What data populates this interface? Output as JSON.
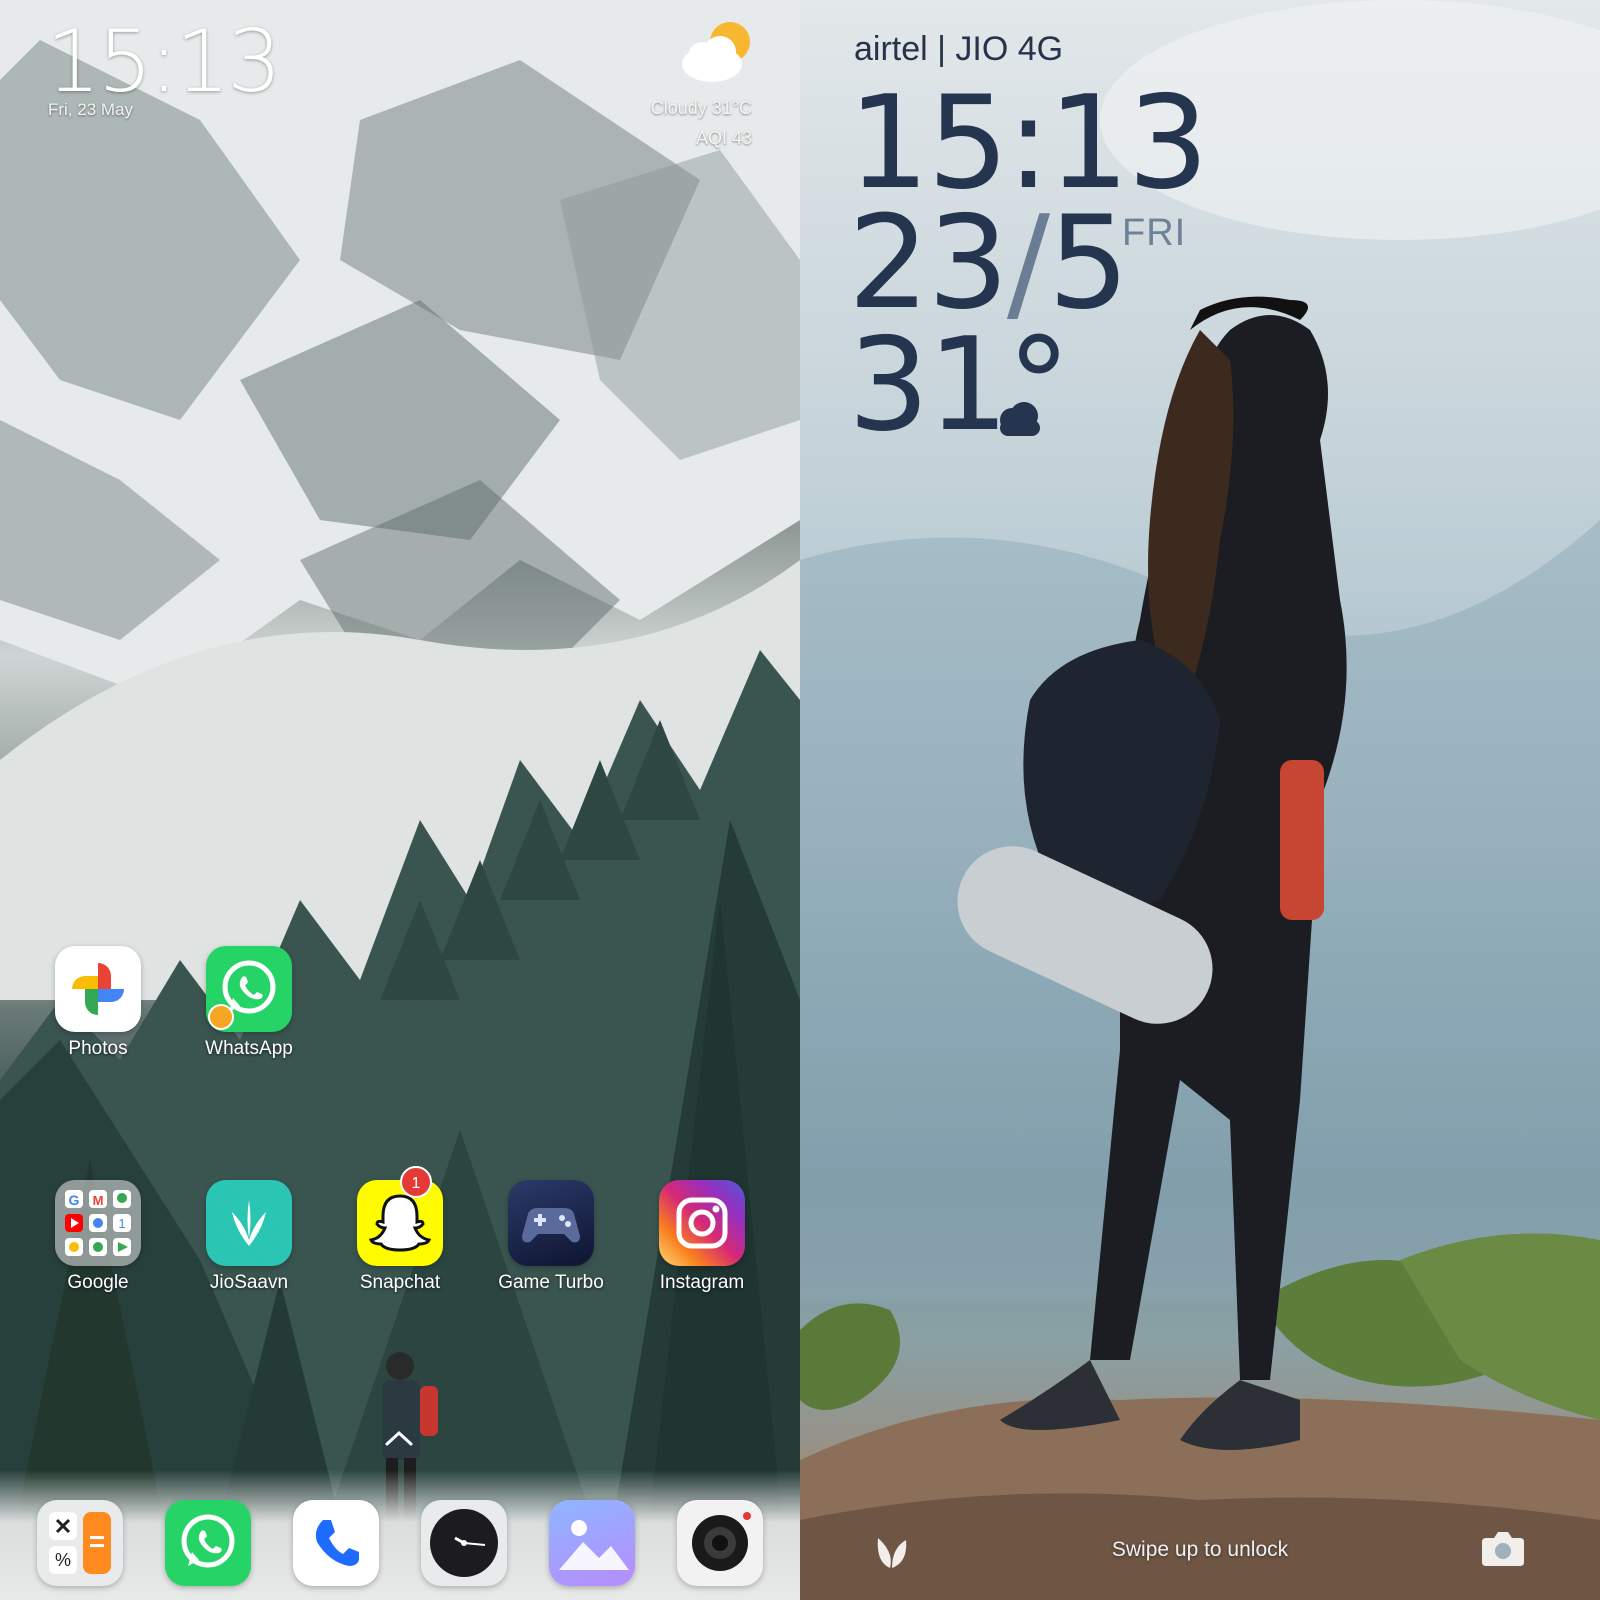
{
  "home": {
    "time": "15:13",
    "date": "Fri, 23 May",
    "weather": "Cloudy  31°C",
    "aqi": "AQI 43",
    "apps_row1": [
      {
        "label": "Photos",
        "icon": "google-photos-icon"
      },
      {
        "label": "WhatsApp",
        "icon": "whatsapp-icon"
      }
    ],
    "apps_row2": [
      {
        "label": "Google",
        "icon": "google-folder-icon"
      },
      {
        "label": "JioSaavn",
        "icon": "jiosaavn-icon"
      },
      {
        "label": "Snapchat",
        "icon": "snapchat-icon",
        "badge": "1"
      },
      {
        "label": "Game Turbo",
        "icon": "gamepad-icon"
      },
      {
        "label": "Instagram",
        "icon": "instagram-icon"
      }
    ],
    "dock": [
      "calculator-icon",
      "whatsapp-icon",
      "phone-icon",
      "clock-icon",
      "gallery-icon",
      "camera-icon"
    ]
  },
  "lock": {
    "carrier": "airtel | JIO 4G",
    "time": "15:13",
    "date_day": "23",
    "date_slash": "/",
    "date_month": "5",
    "weekday": "FRI",
    "temperature": "31°",
    "swipe_hint": "Swipe up to unlock"
  },
  "colors": {
    "whatsapp_green": "#25d366",
    "snapchat_yellow": "#fffc00",
    "jiosaavn_teal": "#2bc5b4",
    "lock_text": "#25344f",
    "badge_red": "#e53935"
  }
}
